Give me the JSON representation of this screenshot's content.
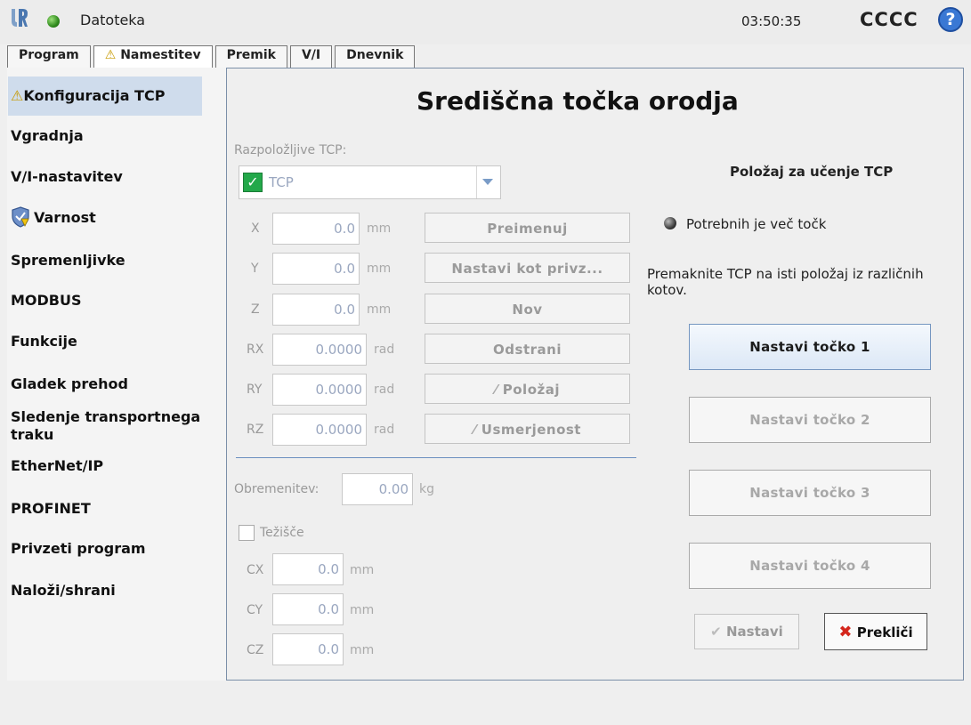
{
  "header": {
    "file_label": "Datoteka",
    "clock": "03:50:35",
    "robot_name": "CCCC",
    "help_label": "?"
  },
  "tabs": [
    {
      "label": "Program"
    },
    {
      "label": "Namestitev",
      "warning": true
    },
    {
      "label": "Premik"
    },
    {
      "label": "V/I"
    },
    {
      "label": "Dnevnik"
    }
  ],
  "sidebar": {
    "items": [
      {
        "label": "Konfiguracija TCP"
      },
      {
        "label": "Vgradnja"
      },
      {
        "label": "V/I-nastavitev"
      },
      {
        "label": "Varnost"
      },
      {
        "label": "Spremenljivke"
      },
      {
        "label": "MODBUS"
      },
      {
        "label": "Funkcije"
      },
      {
        "label": "Gladek prehod"
      },
      {
        "label": "Sledenje transportnega traku"
      },
      {
        "label": "EtherNet/IP"
      },
      {
        "label": "PROFINET"
      },
      {
        "label": "Privzeti program"
      },
      {
        "label": "Naloži/shrani"
      }
    ]
  },
  "main": {
    "title": "Središčna točka orodja",
    "available_tcp_label": "Razpoložljive TCP:",
    "tcp_selected": "TCP",
    "coords": [
      {
        "label": "X",
        "value": "0.0",
        "unit": "mm"
      },
      {
        "label": "Y",
        "value": "0.0",
        "unit": "mm"
      },
      {
        "label": "Z",
        "value": "0.0",
        "unit": "mm"
      },
      {
        "label": "RX",
        "value": "0.0000",
        "unit": "rad"
      },
      {
        "label": "RY",
        "value": "0.0000",
        "unit": "rad"
      },
      {
        "label": "RZ",
        "value": "0.0000",
        "unit": "rad"
      }
    ],
    "buttons": {
      "rename": "Preimenuj",
      "set_default": "Nastavi kot privz...",
      "new": "Nov",
      "remove": "Odstrani",
      "position": "Položaj",
      "orientation": "Usmerjenost"
    },
    "payload_label": "Obremenitev:",
    "payload_value": "0.00",
    "payload_unit": "kg",
    "cog_label": "Težišče",
    "cog": [
      {
        "label": "CX",
        "value": "0.0",
        "unit": "mm"
      },
      {
        "label": "CY",
        "value": "0.0",
        "unit": "mm"
      },
      {
        "label": "CZ",
        "value": "0.0",
        "unit": "mm"
      }
    ]
  },
  "teach": {
    "title": "Položaj za učenje TCP",
    "status": "Potrebnih je več točk",
    "instruction": "Premaknite TCP na isti položaj iz različnih kotov.",
    "points": [
      "Nastavi točko 1",
      "Nastavi točko 2",
      "Nastavi točko 3",
      "Nastavi točko 4"
    ],
    "apply_label": "Nastavi",
    "cancel_label": "Prekliči"
  }
}
